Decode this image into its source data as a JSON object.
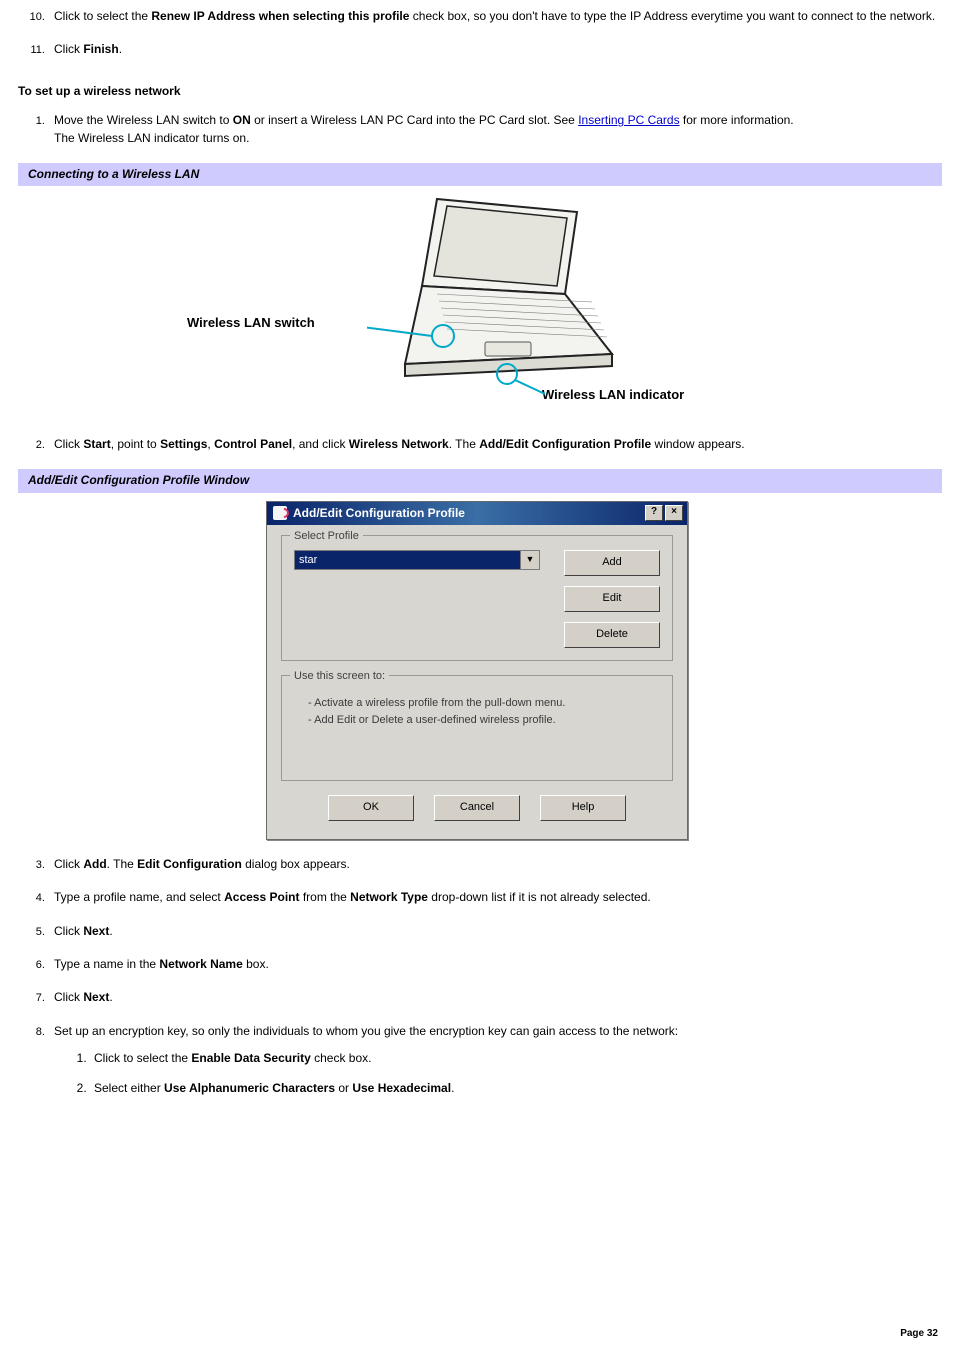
{
  "topList": {
    "start": 10,
    "items": [
      {
        "pre": "Click to select the ",
        "bold1": "Renew IP Address when selecting this profile",
        "post": " check box, so you don't have to type the IP Address everytime you want to connect to the network."
      },
      {
        "pre": "Click ",
        "bold1": "Finish",
        "post": "."
      }
    ]
  },
  "wirelessHeading": "To set up a wireless network",
  "setupList": {
    "item1": {
      "part1": "Move the Wireless LAN switch to ",
      "bold1": "ON",
      "part2": " or insert a Wireless LAN PC Card into the PC Card slot. See ",
      "linkText": "Inserting PC Cards",
      "part3": " for more information.",
      "line2": "The Wireless LAN indicator turns on."
    },
    "item2": {
      "p1": "Click ",
      "b1": "Start",
      "p2": ", point to ",
      "b2": "Settings",
      "p3": ", ",
      "b3": "Control Panel",
      "p4": ", and click ",
      "b4": "Wireless Network",
      "p5": ". The ",
      "b5": "Add/Edit Configuration Profile",
      "p6": " window appears."
    },
    "item3": {
      "p1": "Click ",
      "b1": "Add",
      "p2": ". The ",
      "b2": "Edit Configuration",
      "p3": " dialog box appears."
    },
    "item4": {
      "p1": "Type a profile name, and select ",
      "b1": "Access Point",
      "p2": " from the ",
      "b2": "Network Type",
      "p3": " drop-down list if it is not already selected."
    },
    "item5": {
      "p1": "Click ",
      "b1": "Next",
      "p2": "."
    },
    "item6": {
      "p1": "Type a name in the ",
      "b1": "Network Name",
      "p2": " box."
    },
    "item7": {
      "p1": "Click ",
      "b1": "Next",
      "p2": "."
    },
    "item8": {
      "text": "Set up an encryption key, so only the individuals to whom you give the encryption key can gain access to the network:",
      "sub1": {
        "p1": "Click to select the ",
        "b1": "Enable Data Security",
        "p2": " check box."
      },
      "sub2": {
        "p1": "Select either ",
        "b1": "Use Alphanumeric Characters",
        "p2": " or ",
        "b2": "Use Hexadecimal",
        "p3": "."
      }
    }
  },
  "bar1": "Connecting to a Wireless LAN",
  "bar2": "Add/Edit Configuration Profile Window",
  "figure": {
    "switchLabel": "Wireless LAN switch",
    "indicatorLabel": "Wireless LAN indicator"
  },
  "dialog": {
    "title": "Add/Edit Configuration Profile",
    "helpBtn": "?",
    "closeBtn": "×",
    "group1": "Select Profile",
    "comboValue": "star",
    "comboArrow": "▼",
    "btnAdd": "Add",
    "btnEdit": "Edit",
    "btnDelete": "Delete",
    "group2": "Use this screen to:",
    "useLine1": "-  Activate a wireless profile from the pull-down menu.",
    "useLine2": "-  Add Edit or Delete a user-defined wireless profile.",
    "ok": "OK",
    "cancel": "Cancel",
    "help": "Help"
  },
  "pageNum": "Page 32"
}
